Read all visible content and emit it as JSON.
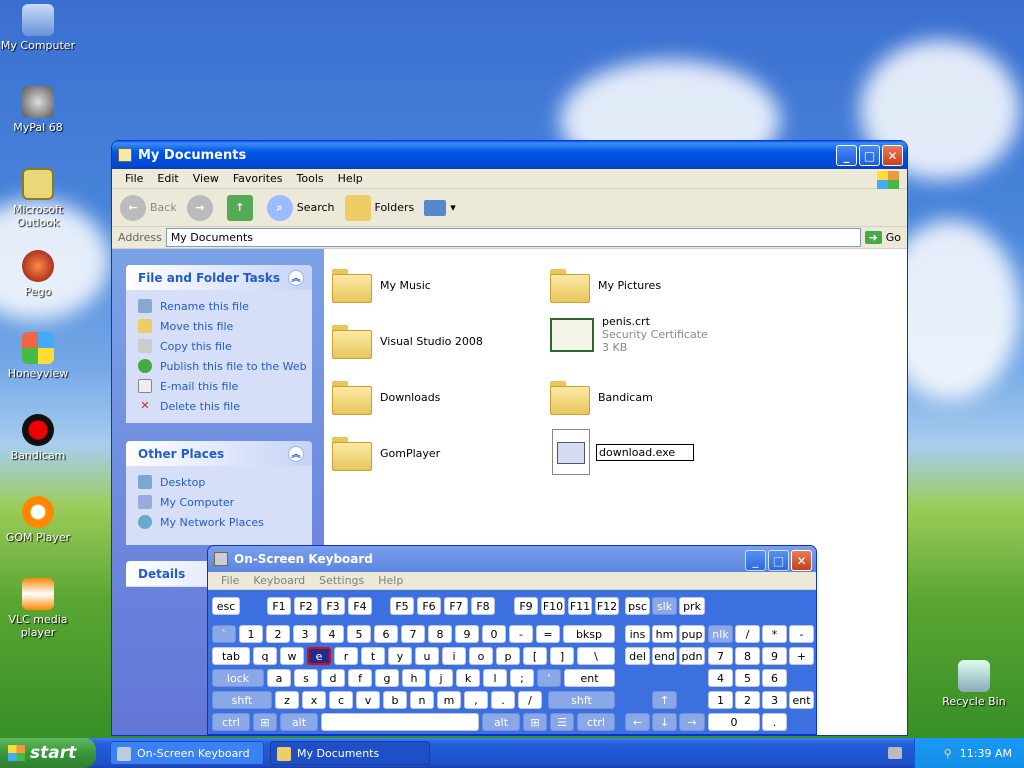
{
  "desktop": {
    "icons": [
      {
        "label": "My Computer",
        "icon": "computer-icon"
      },
      {
        "label": "MyPal 68",
        "icon": "raccoon-icon"
      },
      {
        "label": "Microsoft Outlook",
        "icon": "outlook-icon"
      },
      {
        "label": "Pego",
        "icon": "pego-icon"
      },
      {
        "label": "Honeyview",
        "icon": "honeyview-icon"
      },
      {
        "label": "Bandicam",
        "icon": "bandicam-icon"
      },
      {
        "label": "GOM Player",
        "icon": "gom-icon"
      },
      {
        "label": "VLC media player",
        "icon": "vlc-icon"
      },
      {
        "label": "Recycle Bin",
        "icon": "recycle-bin-icon"
      }
    ]
  },
  "explorer": {
    "title": "My Documents",
    "menu": [
      "File",
      "Edit",
      "View",
      "Favorites",
      "Tools",
      "Help"
    ],
    "toolbar": {
      "back": "Back",
      "search": "Search",
      "folders": "Folders"
    },
    "address_label": "Address",
    "address_value": "My Documents",
    "go": "Go",
    "tasks_title": "File and Folder Tasks",
    "tasks": [
      "Rename this file",
      "Move this file",
      "Copy this file",
      "Publish this file to the Web",
      "E-mail this file",
      "Delete this file"
    ],
    "other_title": "Other Places",
    "other": [
      "Desktop",
      "My Computer",
      "My Network Places"
    ],
    "details_title": "Details",
    "items": [
      {
        "name": "My Music"
      },
      {
        "name": "My Pictures"
      },
      {
        "name": "Visual Studio 2008"
      },
      {
        "name": "penis.crt",
        "type": "Security Certificate",
        "size": "3 KB"
      },
      {
        "name": "Downloads"
      },
      {
        "name": "Bandicam"
      },
      {
        "name": "GomPlayer"
      },
      {
        "name": "download.exe"
      }
    ]
  },
  "osk": {
    "title": "On-Screen Keyboard",
    "menu": [
      "File",
      "Keyboard",
      "Settings",
      "Help"
    ],
    "pressed": "e"
  },
  "taskbar": {
    "start": "start",
    "tasks": [
      "On-Screen Keyboard",
      "My Documents"
    ],
    "clock": "11:39 AM"
  },
  "colors": {
    "xp_blue": "#0054e3",
    "start_green": "#3a963a",
    "task_link": "#215dc6"
  }
}
